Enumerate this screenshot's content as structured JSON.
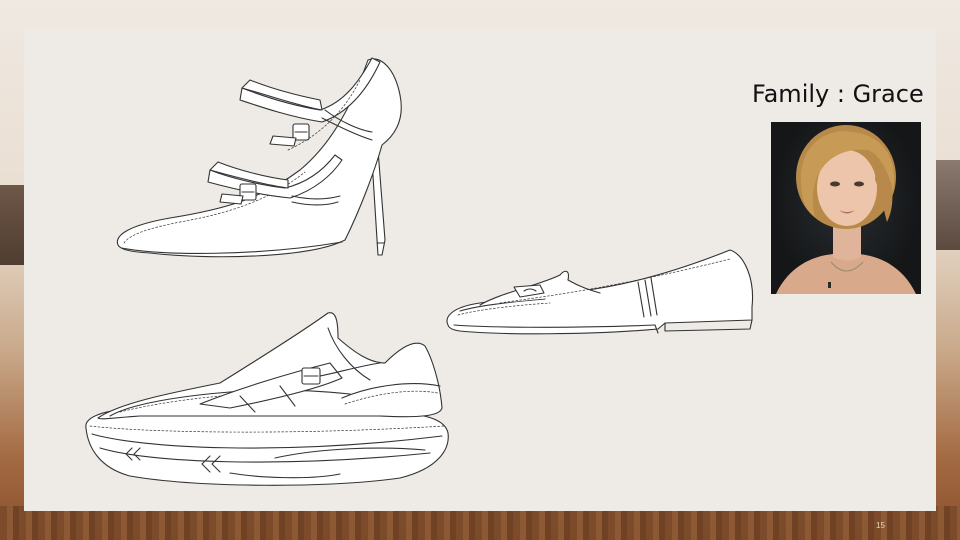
{
  "slide": {
    "title": "Family : Grace",
    "page_number": "15"
  },
  "portrait": {
    "description_icon": "portrait-photo"
  },
  "sketches": [
    {
      "name": "mary-jane-heel-sketch"
    },
    {
      "name": "loafer-flat-sketch"
    },
    {
      "name": "sneaker-sketch"
    }
  ]
}
